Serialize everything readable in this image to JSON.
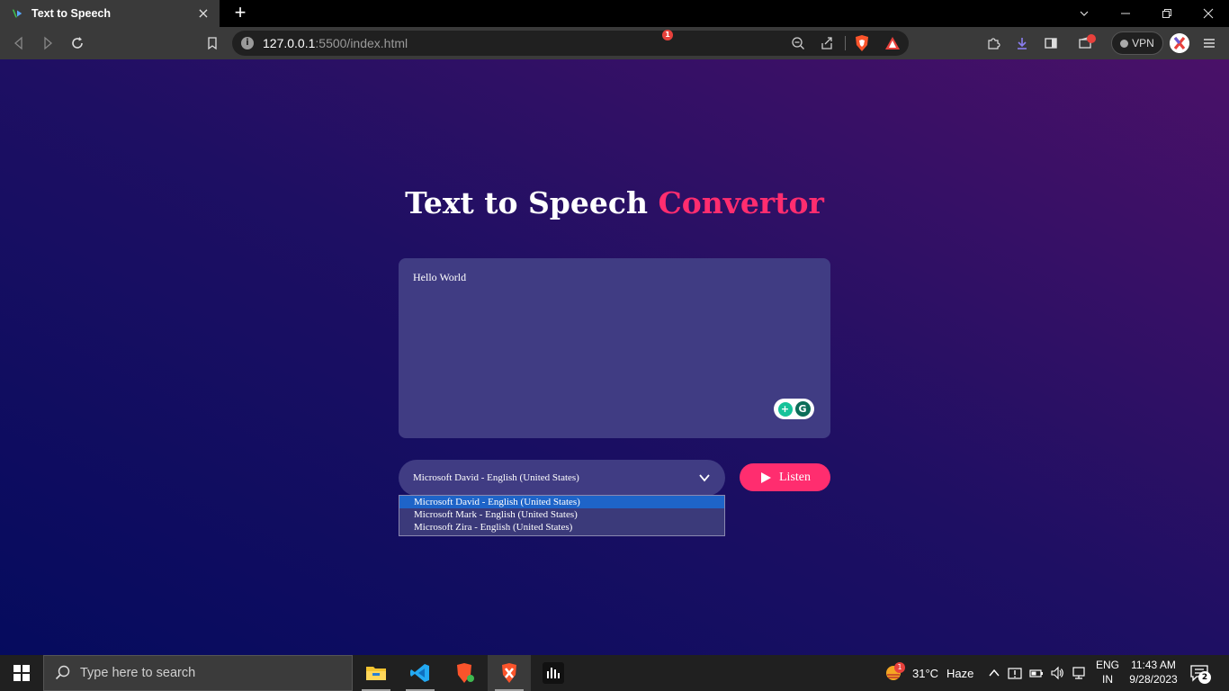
{
  "browser": {
    "tab_title": "Text to Speech",
    "tab_close": "×",
    "new_tab": "+",
    "url_host": "127.0.0.1",
    "url_rest": ":5500/index.html",
    "info_glyph": "i",
    "shields_badge": "1",
    "vpn_label": "VPN"
  },
  "page": {
    "title_main": "Text to Speech",
    "title_accent": "Convertor",
    "textarea_value": "Hello World",
    "grammarly_a": "+",
    "grammarly_b": "G",
    "voice_selected": "Microsoft David - English (United States)",
    "voice_options": [
      "Microsoft David - English (United States)",
      "Microsoft Mark - English (United States)",
      "Microsoft Zira - English (United States)"
    ],
    "listen_label": "Listen"
  },
  "taskbar": {
    "search_placeholder": "Type here to search",
    "weather_badge": "1",
    "temperature": "31°C",
    "condition": "Haze",
    "lang_1": "ENG",
    "lang_2": "IN",
    "time": "11:43 AM",
    "date": "9/28/2023",
    "notif_count": "2"
  },
  "colors": {
    "accent": "#ff2d6f",
    "panel": "#403c83",
    "selected_option": "#1e64c8"
  }
}
